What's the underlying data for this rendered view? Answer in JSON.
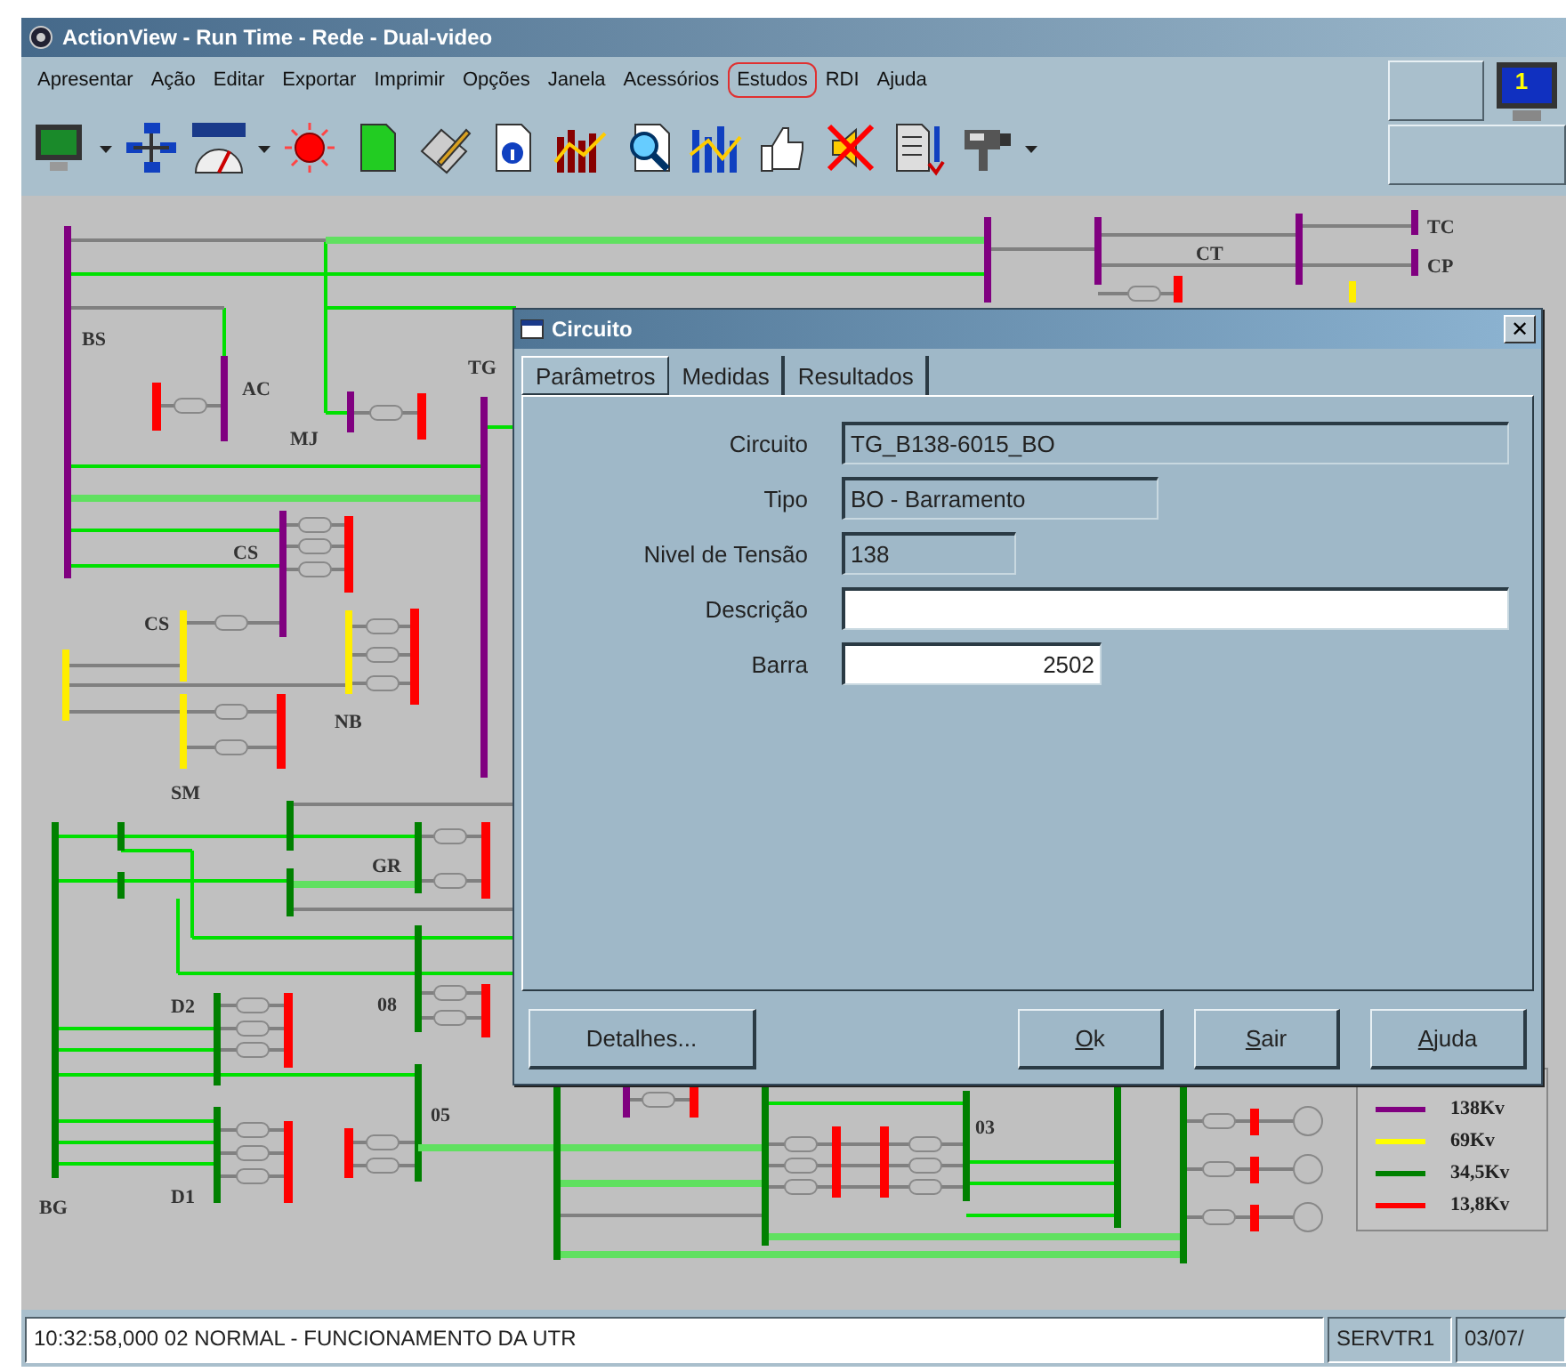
{
  "window": {
    "title": "ActionView - Run Time - Rede - Dual-video"
  },
  "menu": [
    {
      "label": "Apresentar",
      "highlighted": false
    },
    {
      "label": "Ação",
      "highlighted": false
    },
    {
      "label": "Editar",
      "highlighted": false
    },
    {
      "label": "Exportar",
      "highlighted": false
    },
    {
      "label": "Imprimir",
      "highlighted": false
    },
    {
      "label": "Opções",
      "highlighted": false
    },
    {
      "label": "Janela",
      "highlighted": false
    },
    {
      "label": "Acessórios",
      "highlighted": false
    },
    {
      "label": "Estudos",
      "highlighted": true
    },
    {
      "label": "RDI",
      "highlighted": false
    },
    {
      "label": "Ajuda",
      "highlighted": false
    }
  ],
  "monitor_badge": "1",
  "diagram": {
    "labels": [
      "BS",
      "AC",
      "MJ",
      "TG",
      "CS",
      "CS",
      "NB",
      "SM",
      "GR",
      "08",
      "D2",
      "05",
      "D1",
      "BG",
      "03",
      "CT",
      "TC",
      "CP"
    ]
  },
  "legend": [
    {
      "label": "138Kv",
      "color": "#800080"
    },
    {
      "label": "69Kv",
      "color": "#ffff00"
    },
    {
      "label": "34,5Kv",
      "color": "#008000"
    },
    {
      "label": "13,8Kv",
      "color": "#ff0000"
    }
  ],
  "dialog": {
    "title": "Circuito",
    "close": "✕",
    "tabs": [
      {
        "label": "Parâmetros",
        "selected": true
      },
      {
        "label": "Medidas",
        "selected": false
      },
      {
        "label": "Resultados",
        "selected": false
      }
    ],
    "fields": [
      {
        "label": "Circuito",
        "value": "TG_B138-6015_BO",
        "kind": "readonly"
      },
      {
        "label": "Tipo",
        "value": "BO - Barramento",
        "kind": "readonly"
      },
      {
        "label": "Nivel de Tensão",
        "value": "138",
        "kind": "readonly"
      },
      {
        "label": "Descrição",
        "kind": "editable"
      },
      {
        "label": "Barra",
        "value": "2502",
        "kind": "numeric"
      }
    ],
    "buttons": [
      {
        "label": "Detalhes...",
        "mnemonic": false
      },
      {
        "label": "Ok",
        "mnemonic": true
      },
      {
        "label": "Sair",
        "mnemonic": true
      },
      {
        "label": "Ajuda",
        "mnemonic": true
      }
    ]
  },
  "status_bar": {
    "message": "10:32:58,000  02 NORMAL - FUNCIONAMENTO DA UTR",
    "server": "SERVTR1",
    "date": "03/07/"
  }
}
